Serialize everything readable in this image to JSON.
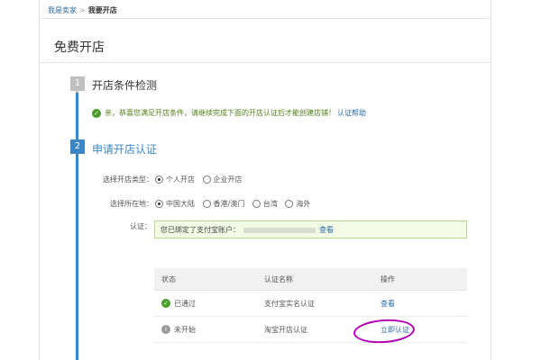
{
  "breadcrumb": {
    "parent": "我是卖家",
    "separator": ">",
    "current": "我要开店"
  },
  "page": {
    "title": "免费开店"
  },
  "steps": [
    {
      "number": "1",
      "title": "开店条件检测"
    },
    {
      "number": "2",
      "title": "申请开店认证"
    }
  ],
  "notice": {
    "text": "亲，恭喜您满足开店条件，请继续完成下面的开店认证后才能创建店铺！",
    "link": "认证帮助"
  },
  "shop_type": {
    "label": "选择开店类型：",
    "options": [
      "个人开店",
      "企业开店"
    ],
    "selected": "个人开店"
  },
  "location": {
    "label": "选择所在地：",
    "options": [
      "中国大陆",
      "香港/澳门",
      "台湾",
      "海外"
    ],
    "selected": "中国大陆"
  },
  "certification": {
    "label": "认证：",
    "text": "您已绑定了支付宝账户：",
    "link": "查看"
  },
  "table": {
    "headers": [
      "状态",
      "认证名称",
      "操作"
    ],
    "rows": [
      {
        "status": "已通过",
        "name": "支付宝实名认证",
        "action": "查看"
      },
      {
        "status": "未开始",
        "name": "淘宝开店认证",
        "action": "立即认证"
      }
    ]
  },
  "colors": {
    "accent": "#3b86c4",
    "success": "#4a9d2a",
    "highlight": "#b400b4"
  }
}
